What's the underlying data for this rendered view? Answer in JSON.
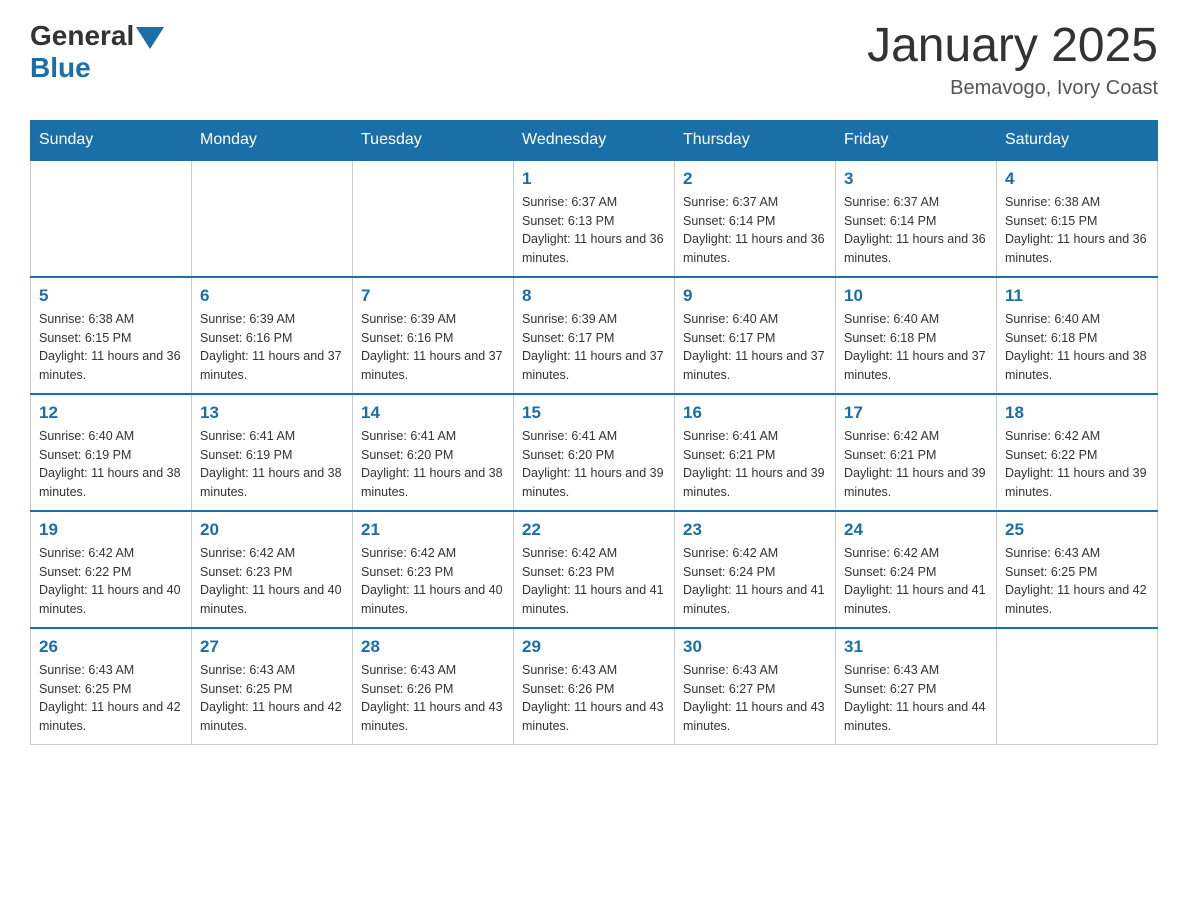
{
  "header": {
    "logo_general": "General",
    "logo_blue": "Blue",
    "month_year": "January 2025",
    "location": "Bemavogo, Ivory Coast"
  },
  "days_of_week": [
    "Sunday",
    "Monday",
    "Tuesday",
    "Wednesday",
    "Thursday",
    "Friday",
    "Saturday"
  ],
  "weeks": [
    [
      {
        "day": "",
        "sunrise": "",
        "sunset": "",
        "daylight": ""
      },
      {
        "day": "",
        "sunrise": "",
        "sunset": "",
        "daylight": ""
      },
      {
        "day": "",
        "sunrise": "",
        "sunset": "",
        "daylight": ""
      },
      {
        "day": "1",
        "sunrise": "Sunrise: 6:37 AM",
        "sunset": "Sunset: 6:13 PM",
        "daylight": "Daylight: 11 hours and 36 minutes."
      },
      {
        "day": "2",
        "sunrise": "Sunrise: 6:37 AM",
        "sunset": "Sunset: 6:14 PM",
        "daylight": "Daylight: 11 hours and 36 minutes."
      },
      {
        "day": "3",
        "sunrise": "Sunrise: 6:37 AM",
        "sunset": "Sunset: 6:14 PM",
        "daylight": "Daylight: 11 hours and 36 minutes."
      },
      {
        "day": "4",
        "sunrise": "Sunrise: 6:38 AM",
        "sunset": "Sunset: 6:15 PM",
        "daylight": "Daylight: 11 hours and 36 minutes."
      }
    ],
    [
      {
        "day": "5",
        "sunrise": "Sunrise: 6:38 AM",
        "sunset": "Sunset: 6:15 PM",
        "daylight": "Daylight: 11 hours and 36 minutes."
      },
      {
        "day": "6",
        "sunrise": "Sunrise: 6:39 AM",
        "sunset": "Sunset: 6:16 PM",
        "daylight": "Daylight: 11 hours and 37 minutes."
      },
      {
        "day": "7",
        "sunrise": "Sunrise: 6:39 AM",
        "sunset": "Sunset: 6:16 PM",
        "daylight": "Daylight: 11 hours and 37 minutes."
      },
      {
        "day": "8",
        "sunrise": "Sunrise: 6:39 AM",
        "sunset": "Sunset: 6:17 PM",
        "daylight": "Daylight: 11 hours and 37 minutes."
      },
      {
        "day": "9",
        "sunrise": "Sunrise: 6:40 AM",
        "sunset": "Sunset: 6:17 PM",
        "daylight": "Daylight: 11 hours and 37 minutes."
      },
      {
        "day": "10",
        "sunrise": "Sunrise: 6:40 AM",
        "sunset": "Sunset: 6:18 PM",
        "daylight": "Daylight: 11 hours and 37 minutes."
      },
      {
        "day": "11",
        "sunrise": "Sunrise: 6:40 AM",
        "sunset": "Sunset: 6:18 PM",
        "daylight": "Daylight: 11 hours and 38 minutes."
      }
    ],
    [
      {
        "day": "12",
        "sunrise": "Sunrise: 6:40 AM",
        "sunset": "Sunset: 6:19 PM",
        "daylight": "Daylight: 11 hours and 38 minutes."
      },
      {
        "day": "13",
        "sunrise": "Sunrise: 6:41 AM",
        "sunset": "Sunset: 6:19 PM",
        "daylight": "Daylight: 11 hours and 38 minutes."
      },
      {
        "day": "14",
        "sunrise": "Sunrise: 6:41 AM",
        "sunset": "Sunset: 6:20 PM",
        "daylight": "Daylight: 11 hours and 38 minutes."
      },
      {
        "day": "15",
        "sunrise": "Sunrise: 6:41 AM",
        "sunset": "Sunset: 6:20 PM",
        "daylight": "Daylight: 11 hours and 39 minutes."
      },
      {
        "day": "16",
        "sunrise": "Sunrise: 6:41 AM",
        "sunset": "Sunset: 6:21 PM",
        "daylight": "Daylight: 11 hours and 39 minutes."
      },
      {
        "day": "17",
        "sunrise": "Sunrise: 6:42 AM",
        "sunset": "Sunset: 6:21 PM",
        "daylight": "Daylight: 11 hours and 39 minutes."
      },
      {
        "day": "18",
        "sunrise": "Sunrise: 6:42 AM",
        "sunset": "Sunset: 6:22 PM",
        "daylight": "Daylight: 11 hours and 39 minutes."
      }
    ],
    [
      {
        "day": "19",
        "sunrise": "Sunrise: 6:42 AM",
        "sunset": "Sunset: 6:22 PM",
        "daylight": "Daylight: 11 hours and 40 minutes."
      },
      {
        "day": "20",
        "sunrise": "Sunrise: 6:42 AM",
        "sunset": "Sunset: 6:23 PM",
        "daylight": "Daylight: 11 hours and 40 minutes."
      },
      {
        "day": "21",
        "sunrise": "Sunrise: 6:42 AM",
        "sunset": "Sunset: 6:23 PM",
        "daylight": "Daylight: 11 hours and 40 minutes."
      },
      {
        "day": "22",
        "sunrise": "Sunrise: 6:42 AM",
        "sunset": "Sunset: 6:23 PM",
        "daylight": "Daylight: 11 hours and 41 minutes."
      },
      {
        "day": "23",
        "sunrise": "Sunrise: 6:42 AM",
        "sunset": "Sunset: 6:24 PM",
        "daylight": "Daylight: 11 hours and 41 minutes."
      },
      {
        "day": "24",
        "sunrise": "Sunrise: 6:42 AM",
        "sunset": "Sunset: 6:24 PM",
        "daylight": "Daylight: 11 hours and 41 minutes."
      },
      {
        "day": "25",
        "sunrise": "Sunrise: 6:43 AM",
        "sunset": "Sunset: 6:25 PM",
        "daylight": "Daylight: 11 hours and 42 minutes."
      }
    ],
    [
      {
        "day": "26",
        "sunrise": "Sunrise: 6:43 AM",
        "sunset": "Sunset: 6:25 PM",
        "daylight": "Daylight: 11 hours and 42 minutes."
      },
      {
        "day": "27",
        "sunrise": "Sunrise: 6:43 AM",
        "sunset": "Sunset: 6:25 PM",
        "daylight": "Daylight: 11 hours and 42 minutes."
      },
      {
        "day": "28",
        "sunrise": "Sunrise: 6:43 AM",
        "sunset": "Sunset: 6:26 PM",
        "daylight": "Daylight: 11 hours and 43 minutes."
      },
      {
        "day": "29",
        "sunrise": "Sunrise: 6:43 AM",
        "sunset": "Sunset: 6:26 PM",
        "daylight": "Daylight: 11 hours and 43 minutes."
      },
      {
        "day": "30",
        "sunrise": "Sunrise: 6:43 AM",
        "sunset": "Sunset: 6:27 PM",
        "daylight": "Daylight: 11 hours and 43 minutes."
      },
      {
        "day": "31",
        "sunrise": "Sunrise: 6:43 AM",
        "sunset": "Sunset: 6:27 PM",
        "daylight": "Daylight: 11 hours and 44 minutes."
      },
      {
        "day": "",
        "sunrise": "",
        "sunset": "",
        "daylight": ""
      }
    ]
  ]
}
